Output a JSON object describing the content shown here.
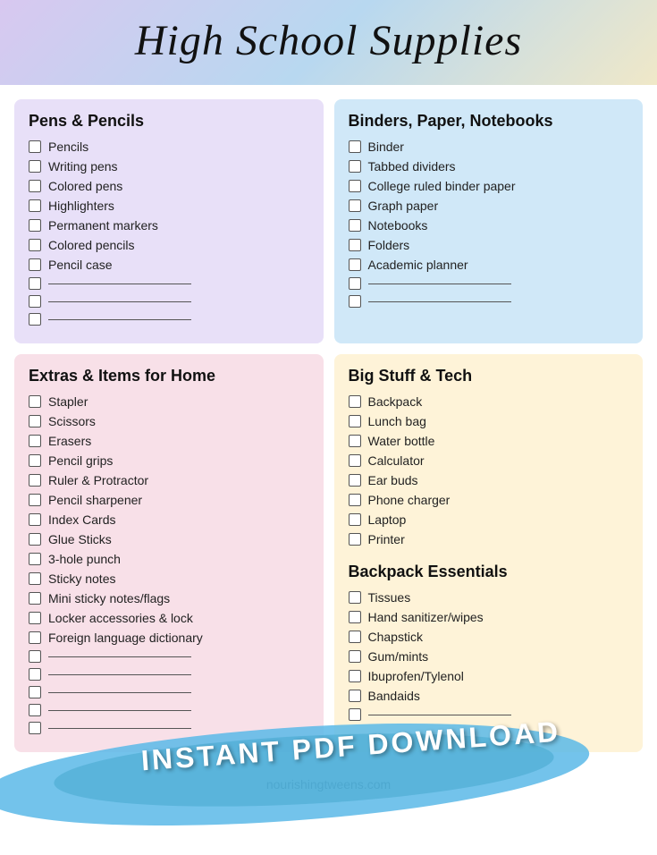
{
  "header": {
    "title": "High School Supplies"
  },
  "sections": {
    "pens": {
      "title": "Pens & Pencils",
      "items": [
        "Pencils",
        "Writing pens",
        "Colored pens",
        "Highlighters",
        "Permanent markers",
        "Colored pencils",
        "Pencil case"
      ],
      "blanks": 3
    },
    "binders": {
      "title": "Binders, Paper, Notebooks",
      "items": [
        "Binder",
        "Tabbed dividers",
        "College ruled binder paper",
        "Graph paper",
        "Notebooks",
        "Folders",
        "Academic planner"
      ],
      "blanks": 2
    },
    "extras": {
      "title": "Extras & Items for Home",
      "items": [
        "Stapler",
        "Scissors",
        "Erasers",
        "Pencil grips",
        "Ruler & Protractor",
        "Pencil sharpener",
        "Index Cards",
        "Glue Sticks",
        "3-hole punch",
        "Sticky notes",
        "Mini sticky notes/flags",
        "Locker accessories & lock",
        "Foreign language dictionary"
      ],
      "blanks": 5
    },
    "bigstuff": {
      "title": "Big Stuff & Tech",
      "items": [
        "Backpack",
        "Lunch bag",
        "Water bottle",
        "Calculator",
        "Ear buds",
        "Phone charger",
        "Laptop",
        "Printer"
      ]
    },
    "backpack": {
      "title": "Backpack Essentials",
      "items": [
        "Tissues",
        "Hand sanitizer/wipes",
        "Chapstick",
        "Gum/mints",
        "Ibuprofen/Tylenol",
        "Bandaids"
      ],
      "blanks": 1
    }
  },
  "stamp": {
    "line1": "INSTANT PDF DOWNLOAD"
  },
  "footer": {
    "text": "nourishingtweens.com"
  }
}
